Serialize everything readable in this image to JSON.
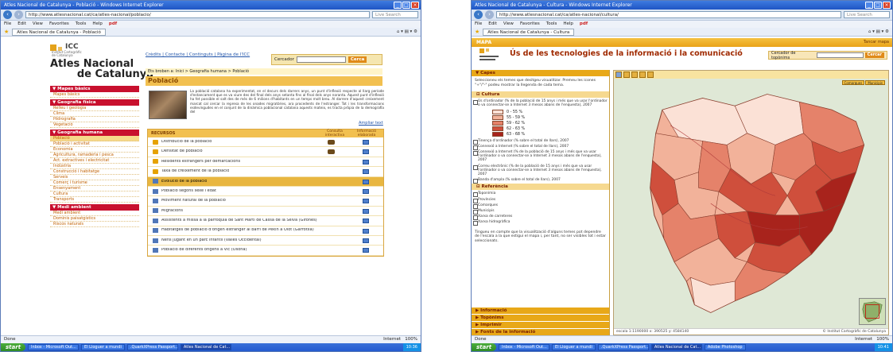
{
  "left": {
    "window_title": "Atles Nacional de Catalunya - Població - Windows Internet Explorer",
    "url": "http://www.atlesnacional.cat/ca/atles-nacional/poblacio/",
    "search_placeholder": "Live Search",
    "menu": [
      "File",
      "Edit",
      "View",
      "Favorites",
      "Tools",
      "Help"
    ],
    "pdf_label": "pdf",
    "tab_title": "Atles Nacional de Catalunya - Població",
    "logo": {
      "icc": "ICC",
      "inst_line1": "Institut Cartogràfic",
      "inst_line2": "de Catalunya",
      "name1": "Atles Nacional",
      "name2": "de Catalunya"
    },
    "top_links": "Crèdits | Contacte | Continguts | Pàgina de l'ICC",
    "search_label": "Cercador",
    "search_button": "Cerca",
    "breadcrumb": "Ets broben a: Inici > Geografia humana > Població",
    "page_title": "Població",
    "intro": "La població catalana ha experimentat, en el decurs dels darrers anys, un punt d'inflexió respecte al llarg període d'estancament que es va viure des del final dels anys setanta fins al final dels anys noranta. Aquest punt d'inflexió ha fet possible el salt des de més de 6 milions d'habitants en un temps molt breu. Al darrere d'aquest creixement marcat cal cercar la represa de les onades migratòries, ara procedents de l'estranger. Tot i les transformacions esdevingudes en el conjunt de la dinàmica poblacional catalana aquests mateix, es tracta pròpia de la demografia del",
    "more_link": "Ampliar text",
    "sidebar": [
      {
        "title": "Mapes bàsics",
        "items": [
          "Mapes bàsics"
        ]
      },
      {
        "title": "Geografia física",
        "items": [
          "Relleu i geologia",
          "Clima",
          "Hidrografia",
          "Vegetació"
        ]
      },
      {
        "title": "Geografia humana",
        "items": [
          "Població",
          "Població i activitat",
          "Economia",
          "Agricultura, ramaderia i pesca",
          "Act. extractives i electricitat",
          "Indústria",
          "Construcció i habitatge",
          "Serveis",
          "Comerç i turisme",
          "Ensenyament",
          "Cultura",
          "Transports"
        ]
      },
      {
        "title": "Medi ambient",
        "items": [
          "Medi ambient",
          "Dominis paisatgístics",
          "Riscos naturals"
        ]
      }
    ],
    "resources": {
      "head": "RECURSOS",
      "col1": "Consulta interactiva",
      "col2": "Informació elaborada",
      "rows": [
        {
          "text": "Distribució de la població",
          "icon": "folder",
          "globe": true,
          "check": true
        },
        {
          "text": "Densitat de població",
          "icon": "folder",
          "globe": true,
          "check": true
        },
        {
          "text": "Residents estrangers per demarcacions",
          "icon": "folder",
          "globe": false,
          "check": true
        },
        {
          "text": "Taxa de creixement de la població",
          "icon": "folder",
          "globe": false,
          "check": true
        },
        {
          "text": "Evolució de la població",
          "icon": "image",
          "globe": false,
          "check": true
        },
        {
          "text": "Població segons sexe i edat",
          "icon": "image",
          "globe": false,
          "check": true
        },
        {
          "text": "Moviment natural de la població",
          "icon": "image",
          "globe": false,
          "check": true
        },
        {
          "text": "Migracions",
          "icon": "image",
          "globe": false,
          "check": true
        },
        {
          "text": "Assistents a missa a la parròquia de Sant Martí de Cassà de la Selva (Gironès)",
          "icon": "image",
          "globe": false,
          "check": true
        },
        {
          "text": "Habitatges de població d'origen estranger al barri de Pekin a Olot (Garrotxa)",
          "icon": "image",
          "globe": false,
          "check": true
        },
        {
          "text": "Nens jugant en un parc infantil (Vallès Occidental)",
          "icon": "image",
          "globe": false,
          "check": true
        },
        {
          "text": "Població de diferents orígens a Vic (Osona)",
          "icon": "image",
          "globe": false,
          "check": true
        }
      ]
    },
    "status_left": "Done",
    "status_right": "Internet",
    "zoom": "100%",
    "taskbar": [
      "Inbox - Microsoft Out...",
      "El Lloguer a mundi",
      ".QuarkXPress Passport...",
      "Atles Nacional de Cat..."
    ],
    "clock": "10:36"
  },
  "right": {
    "window_title": "Atles Nacional de Catalunya - Cultura - Windows Internet Explorer",
    "url": "http://www.atlesnacional.cat/ca/atles-nacional/cultura/",
    "search_placeholder": "Live Search",
    "menu": [
      "File",
      "Edit",
      "View",
      "Favorites",
      "Tools",
      "Help"
    ],
    "pdf_label": "pdf",
    "tab_title": "Atles Nacional de Catalunya - Cultura",
    "map_tab": "MAPA",
    "map_close": "Tancar mapa",
    "title": "Ús de les tecnologies de la informació i la comunicació",
    "search_label": "Cercador de topònims",
    "search_button": "Cercar",
    "layers_head": "Capes",
    "layers_intro": "Seleccioneu els temes que desitgeu visualitzar. Premeu les icones \"+\"/\"-\" podeu mostrar la llegenda de cada tema.",
    "group1": "Cultura",
    "layer_main": "Ús d'ordinador (% de la població de 15 anys i més que va usar l'ordinador o va connectar-se a Internet 3 mesos abans de l'enquesta), 2007",
    "legend": [
      {
        "label": "0 - 55 %",
        "color": "#fbe1d6"
      },
      {
        "label": "55 - 59 %",
        "color": "#f2b29a"
      },
      {
        "label": "59 - 62 %",
        "color": "#e5826a"
      },
      {
        "label": "62 - 63 %",
        "color": "#cf4f3c"
      },
      {
        "label": "63 - 68 %",
        "color": "#a8231c"
      }
    ],
    "layers_more": [
      "Tinença d'ordinador (% sobre el total de llars), 2007",
      "Connexió a Internet (% sobre el total de llars), 2007",
      "Connexió a Internet (% de la població de 15 anys i més que va usar l'ordinador o va connectar-se a Internet 3 mesos abans de l'enquesta), 2007",
      "Correu electrònic (% de la població de 15 anys i més que va usar l'ordinador o va connectar-se a Internet 3 mesos abans de l'enquesta), 2007",
      "Banda d'ampla (% sobre el total de llars), 2007"
    ],
    "group2": "Referència",
    "ref_layers": [
      "Toponímia",
      "Províncies",
      "Comarques",
      "Municipis",
      "Xarxa de carreteres",
      "Xarxa hidrogràfica"
    ],
    "note": "Tingueu en compte que la visualització d'alguns temes pot dependre de l'escala a la que estigui el mapa i, per tant, no ser visibles tot i estar seleccionats.",
    "bottom_tabs": [
      "Informació",
      "Topònims",
      "Imprimir",
      "Fonts de la informació"
    ],
    "map_nav": [
      "Comarques",
      "Municipis"
    ],
    "scale": "escala 1:1190000 x: 390525 y: 4584140",
    "copyright": "© Institut Cartogràfic de Catalunya",
    "status_left": "Done",
    "status_right": "Internet",
    "zoom": "100%",
    "taskbar": [
      "Inbox - Microsoft Out...",
      "El Lloguer a mundi",
      ".QuarkXPress Passport...",
      "Atles Nacional de Cat...",
      "Adobe Photoshop"
    ],
    "clock": "10:41"
  }
}
